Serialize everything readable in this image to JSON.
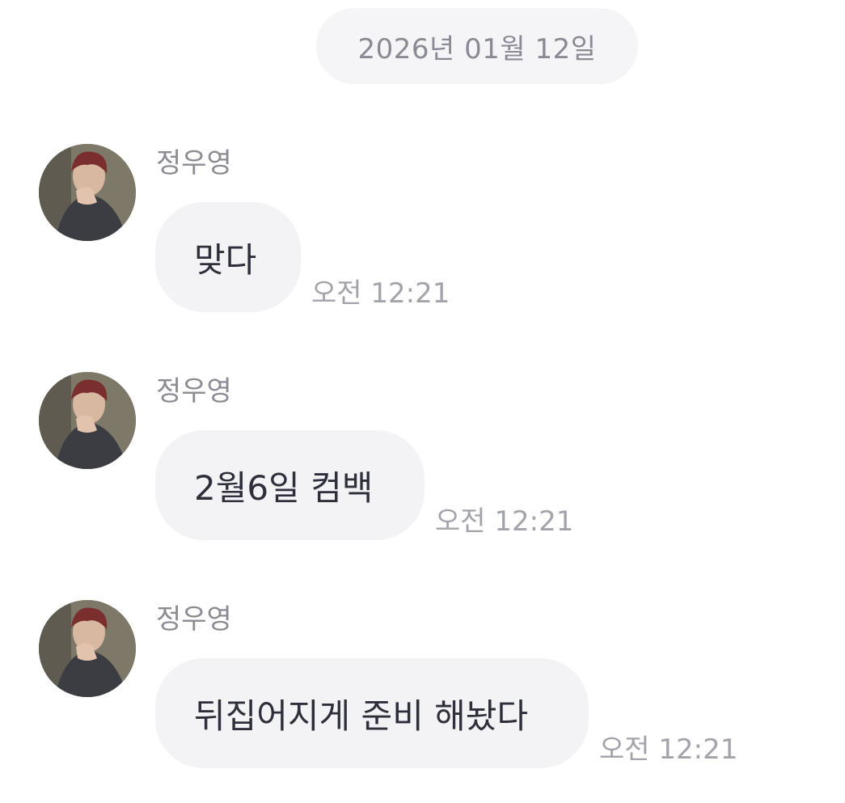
{
  "chat": {
    "date_label": "2026년 01월 12일",
    "messages": [
      {
        "sender": "정우영",
        "text": "맞다",
        "time": "오전 12:21"
      },
      {
        "sender": "정우영",
        "text": "2월6일 컴백",
        "time": "오전 12:21"
      },
      {
        "sender": "정우영",
        "text": "뒤집어지게 준비 해놨다",
        "time": "오전 12:21"
      }
    ]
  },
  "colors": {
    "date_pill_bg": "#f5f5f8",
    "bubble_bg": "#f3f3f6",
    "sender_text": "#8b8b93",
    "time_text": "#a3a3ab",
    "message_text": "#2e2f3a"
  },
  "icons": {
    "avatar": "profile-photo"
  }
}
